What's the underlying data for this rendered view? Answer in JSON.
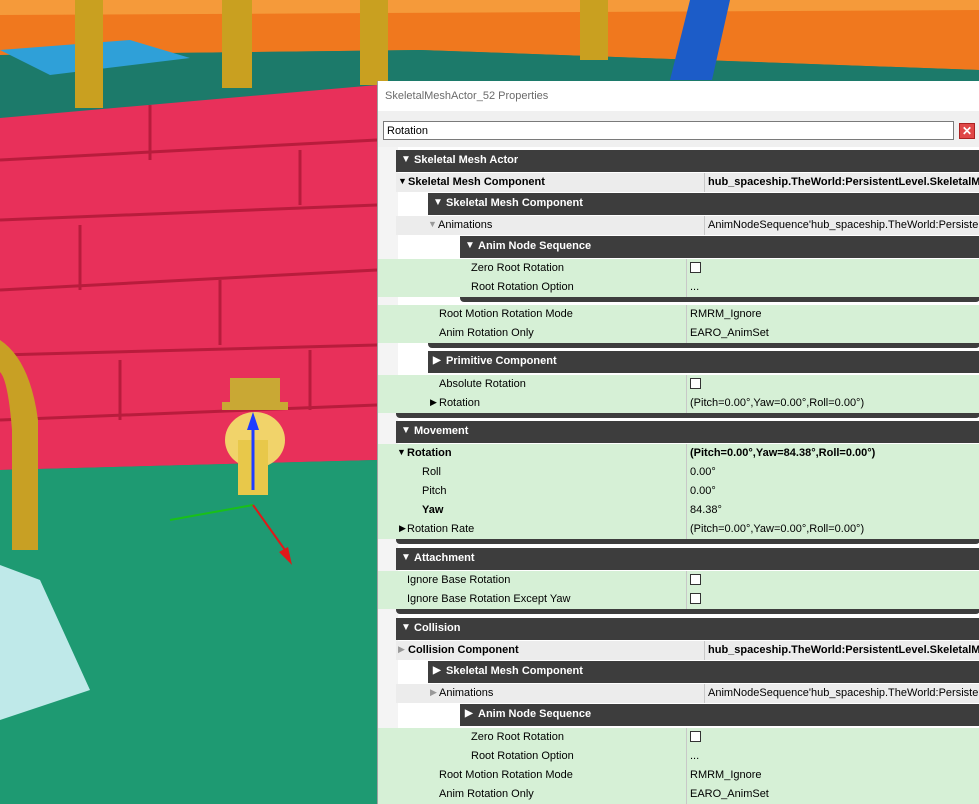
{
  "window": {
    "title": "SkeletalMeshActor_52 Properties"
  },
  "search": {
    "value": "Rotation",
    "clear_icon": "close-icon"
  },
  "colors": {
    "category_bg": "#3d3d3d",
    "property_bg": "#d6f0d6",
    "clear_button": "#e04848",
    "annotation": "#d01010"
  },
  "sections": {
    "skeletal_mesh_actor": {
      "label": "Skeletal Mesh Actor"
    },
    "skeletal_mesh_component": {
      "label": "Skeletal Mesh Component",
      "value": "hub_spaceship.TheWorld:PersistentLevel.SkeletalM"
    },
    "skeletal_mesh_component_sub": {
      "label": "Skeletal Mesh Component"
    },
    "animations": {
      "label": "Animations",
      "value": "AnimNodeSequence'hub_spaceship.TheWorld:PersistentLevel"
    },
    "anim_node_sequence": {
      "label": "Anim Node Sequence"
    },
    "zero_root_rotation": {
      "label": "Zero Root Rotation"
    },
    "root_rotation_option": {
      "label": "Root Rotation Option",
      "value": "..."
    },
    "root_motion_rotation_mode": {
      "label": "Root Motion Rotation Mode",
      "value": "RMRM_Ignore"
    },
    "anim_rotation_only": {
      "label": "Anim Rotation Only",
      "value": "EARO_AnimSet"
    },
    "primitive_component": {
      "label": "Primitive Component"
    },
    "absolute_rotation": {
      "label": "Absolute Rotation"
    },
    "prim_rotation": {
      "label": "Rotation",
      "value": "(Pitch=0.00°,Yaw=0.00°,Roll=0.00°)"
    },
    "movement": {
      "label": "Movement"
    },
    "rotation": {
      "label": "Rotation",
      "value": "(Pitch=0.00°,Yaw=84.38°,Roll=0.00°)"
    },
    "roll": {
      "label": "Roll",
      "value": "0.00°"
    },
    "pitch": {
      "label": "Pitch",
      "value": "0.00°"
    },
    "yaw": {
      "label": "Yaw",
      "value": "84.38°"
    },
    "rotation_rate": {
      "label": "Rotation Rate",
      "value": "(Pitch=0.00°,Yaw=0.00°,Roll=0.00°)"
    },
    "attachment": {
      "label": "Attachment"
    },
    "ignore_base_rotation": {
      "label": "Ignore Base Rotation"
    },
    "ignore_base_rotation_except_yaw": {
      "label": "Ignore Base Rotation Except Yaw"
    },
    "collision": {
      "label": "Collision"
    },
    "collision_component": {
      "label": "Collision Component",
      "value": "hub_spaceship.TheWorld:PersistentLevel.SkeletalM"
    },
    "c_skeletal_mesh_component": {
      "label": "Skeletal Mesh Component"
    },
    "c_animations": {
      "label": "Animations",
      "value": "AnimNodeSequence'hub_spaceship.TheWorld:PersistentLevel"
    },
    "c_anim_node_sequence": {
      "label": "Anim Node Sequence"
    },
    "c_zero_root_rotation": {
      "label": "Zero Root Rotation"
    },
    "c_root_rotation_option": {
      "label": "Root Rotation Option",
      "value": "..."
    },
    "c_root_motion_rotation_mode": {
      "label": "Root Motion Rotation Mode",
      "value": "RMRM_Ignore"
    },
    "c_anim_rotation_only": {
      "label": "Anim Rotation Only",
      "value": "EARO_AnimSet"
    }
  }
}
